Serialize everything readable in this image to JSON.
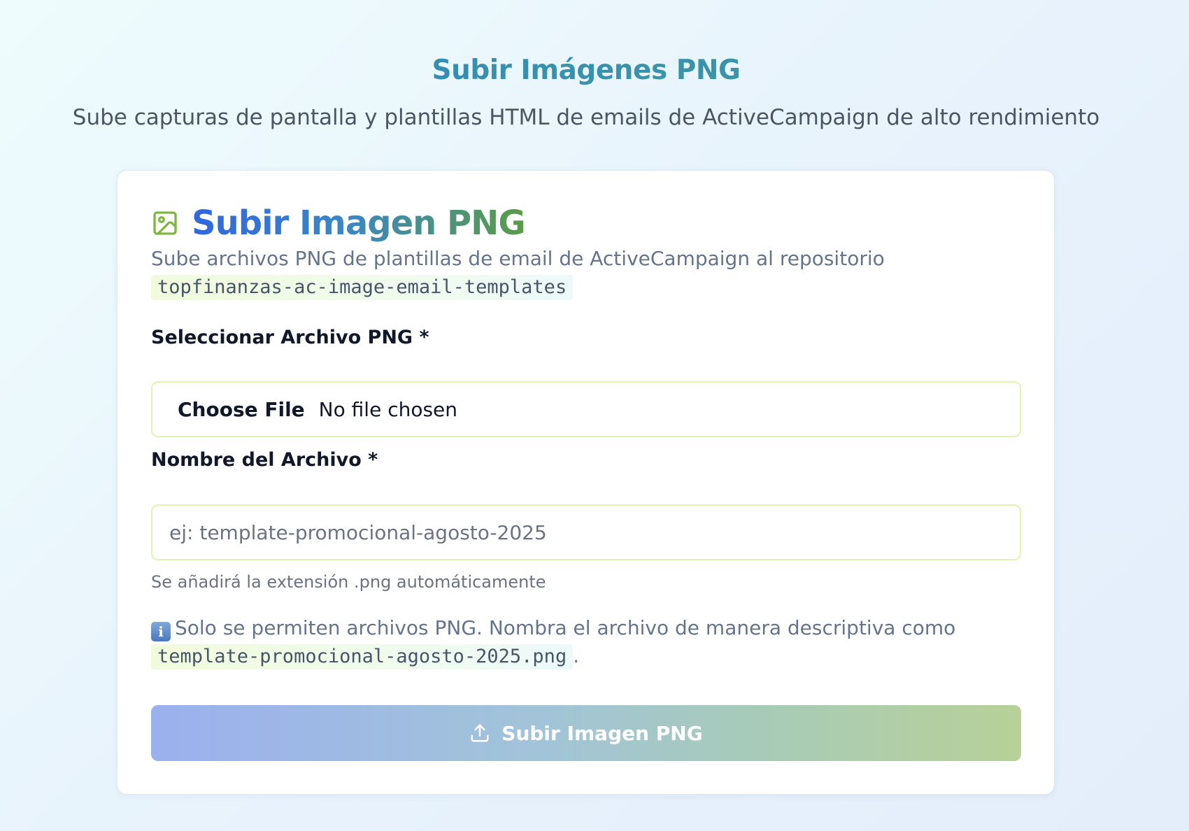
{
  "header": {
    "title": "Subir Imágenes PNG",
    "subtitle": "Sube capturas de pantalla y plantillas HTML de emails de ActiveCampaign de alto rendimiento"
  },
  "card": {
    "icon": "image-icon",
    "title": "Subir Imagen PNG",
    "description": "Sube archivos PNG de plantillas de email de ActiveCampaign al repositorio",
    "repository": "topfinanzas-ac-image-email-templates"
  },
  "file_field": {
    "label": "Seleccionar Archivo PNG *",
    "button_label": "Choose File",
    "status": "No file chosen"
  },
  "name_field": {
    "label": "Nombre del Archivo *",
    "value": "",
    "placeholder": "ej: template-promocional-agosto-2025",
    "hint": "Se añadirá la extensión .png automáticamente"
  },
  "info": {
    "icon": "information-icon",
    "icon_glyph": "i",
    "text": "Solo se permiten archivos PNG. Nombra el archivo de manera descriptiva como",
    "example": "template-promocional-agosto-2025.png",
    "suffix": "."
  },
  "submit": {
    "icon": "upload-icon",
    "label": "Subir Imagen PNG",
    "disabled": true
  },
  "colors": {
    "title_gradient_start": "#2f66e0",
    "title_gradient_end": "#5a9c46",
    "input_border": "#def7b0",
    "button_gradient_start": "#9bb0ee",
    "button_gradient_end": "#b8d198"
  }
}
